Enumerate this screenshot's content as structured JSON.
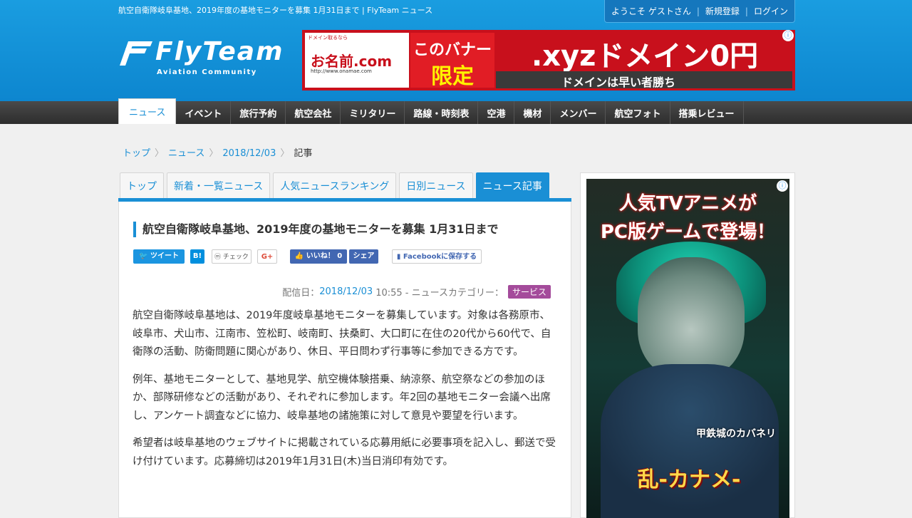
{
  "header": {
    "site_title": "航空自衛隊岐阜基地、2019年度の基地モニターを募集 1月31日まで | FlyTeam ニュース",
    "user_welcome": "ようこそ ゲストさん",
    "register_label": "新規登録",
    "login_label": "ログイン",
    "logo_name": "FlyTeam",
    "logo_sub": "Aviation Community"
  },
  "banner_ad": {
    "small_text": "ドメイン取るなら",
    "brand": "お名前.com",
    "url": "http://www.onamae.com",
    "mid_line1": "このバナー",
    "mid_line2": "限定",
    "main": ".xyzドメイン0円",
    "bottom": "ドメインは早い者勝ち",
    "info": "ⓘ"
  },
  "nav": {
    "items": [
      {
        "label": "ニュース"
      },
      {
        "label": "イベント"
      },
      {
        "label": "旅行予約"
      },
      {
        "label": "航空会社"
      },
      {
        "label": "ミリタリー"
      },
      {
        "label": "路線・時刻表"
      },
      {
        "label": "空港"
      },
      {
        "label": "機材"
      },
      {
        "label": "メンバー"
      },
      {
        "label": "航空フォト"
      },
      {
        "label": "搭乗レビュー"
      }
    ]
  },
  "breadcrumb": {
    "items": [
      "トップ",
      "ニュース",
      "2018/12/03"
    ],
    "current": "記事",
    "sep": "〉"
  },
  "tabs": [
    {
      "label": "トップ"
    },
    {
      "label": "新着・一覧ニュース"
    },
    {
      "label": "人気ニュースランキング"
    },
    {
      "label": "日別ニュース"
    },
    {
      "label": "ニュース記事"
    }
  ],
  "article": {
    "title": "航空自衛隊岐阜基地、2019年度の基地モニターを募集 1月31日まで",
    "social": {
      "tweet": "ツイート",
      "hatena": "B!",
      "mixi": "チェック",
      "gplus": "G+",
      "like": "いいね！ 0",
      "share": "シェア",
      "fb_save": "Facebookに保存する"
    },
    "meta": {
      "prefix": "配信日：",
      "date": "2018/12/03",
      "time": "10:55 - ニュースカテゴリー：",
      "category": "サービス"
    },
    "paragraphs": [
      "航空自衛隊岐阜基地は、2019年度岐阜基地モニターを募集しています。対象は各務原市、岐阜市、犬山市、江南市、笠松町、岐南町、扶桑町、大口町に在住の20代から60代で、自衛隊の活動、防衛問題に関心があり、休日、平日問わず行事等に参加できる方です。",
      "例年、基地モニターとして、基地見学、航空機体験搭乗、納涼祭、航空祭などの参加のほか、部隊研修などの活動があり、それぞれに参加します。年2回の基地モニター会議へ出席し、アンケート調査などに協力、岐阜基地の諸施策に対して意見や要望を行います。",
      "希望者は岐阜基地のウェブサイトに掲載されている応募用紙に必要事項を記入し、郵送で受け付けています。応募締切は2019年1月31日(木)当日消印有効です。"
    ]
  },
  "side_ad": {
    "line1": "人気TVアニメが",
    "line2": "PC版ゲームで登場！",
    "seal": "甲鉄城のカバネリ",
    "title": "乱-カナメ-",
    "info": "ⓘ"
  }
}
